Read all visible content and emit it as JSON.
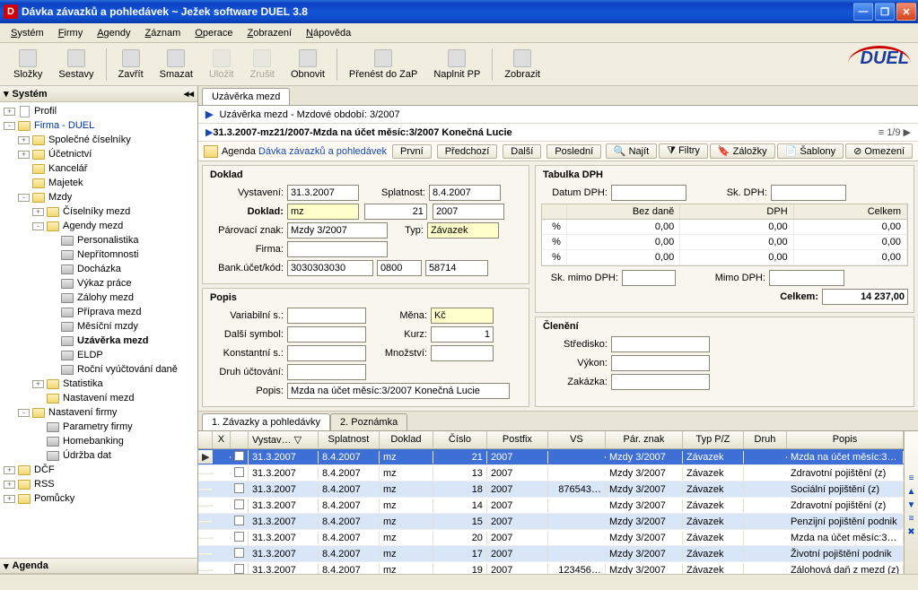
{
  "window": {
    "title": "Dávka závazků a pohledávek ~ Ježek software DUEL 3.8",
    "appIconLetter": "D"
  },
  "menu": [
    "Systém",
    "Firmy",
    "Agendy",
    "Záznam",
    "Operace",
    "Zobrazení",
    "Nápověda"
  ],
  "toolbar": {
    "items": [
      {
        "label": "Složky",
        "disabled": false
      },
      {
        "label": "Sestavy",
        "disabled": false
      },
      {
        "sep": true
      },
      {
        "label": "Zavřít",
        "disabled": false
      },
      {
        "label": "Smazat",
        "disabled": false
      },
      {
        "label": "Uložit",
        "disabled": true
      },
      {
        "label": "Zrušit",
        "disabled": true
      },
      {
        "label": "Obnovit",
        "disabled": false
      },
      {
        "sep": true
      },
      {
        "label": "Přenést do ZaP",
        "disabled": false
      },
      {
        "label": "Naplnit PP",
        "disabled": false
      },
      {
        "sep": true
      },
      {
        "label": "Zobrazit",
        "disabled": false
      }
    ],
    "logo": "DUEL"
  },
  "leftPane": {
    "header": "Systém",
    "footer": "Agenda",
    "tree": [
      {
        "d": 0,
        "tw": "+",
        "ico": "page",
        "label": "Profil"
      },
      {
        "d": 0,
        "tw": "-",
        "ico": "folder",
        "label": "Firma - DUEL",
        "blue": true
      },
      {
        "d": 1,
        "tw": "+",
        "ico": "folder",
        "label": "Společné číselníky"
      },
      {
        "d": 1,
        "tw": "+",
        "ico": "folder",
        "label": "Účetnictví"
      },
      {
        "d": 1,
        "tw": "",
        "ico": "folder",
        "label": "Kancelář"
      },
      {
        "d": 1,
        "tw": "",
        "ico": "folder",
        "label": "Majetek"
      },
      {
        "d": 1,
        "tw": "-",
        "ico": "folder",
        "label": "Mzdy"
      },
      {
        "d": 2,
        "tw": "+",
        "ico": "folder",
        "label": "Číselníky mezd"
      },
      {
        "d": 2,
        "tw": "-",
        "ico": "folder",
        "label": "Agendy mezd"
      },
      {
        "d": 3,
        "tw": "",
        "ico": "folderg",
        "label": "Personalistika"
      },
      {
        "d": 3,
        "tw": "",
        "ico": "folderg",
        "label": "Nepřítomnosti"
      },
      {
        "d": 3,
        "tw": "",
        "ico": "folderg",
        "label": "Docházka"
      },
      {
        "d": 3,
        "tw": "",
        "ico": "folderg",
        "label": "Výkaz práce"
      },
      {
        "d": 3,
        "tw": "",
        "ico": "folderg",
        "label": "Zálohy mezd"
      },
      {
        "d": 3,
        "tw": "",
        "ico": "folderg",
        "label": "Příprava mezd"
      },
      {
        "d": 3,
        "tw": "",
        "ico": "folderg",
        "label": "Měsíční mzdy"
      },
      {
        "d": 3,
        "tw": "",
        "ico": "folderg",
        "label": "Uzávěrka mezd",
        "bold": true
      },
      {
        "d": 3,
        "tw": "",
        "ico": "folderg",
        "label": "ELDP"
      },
      {
        "d": 3,
        "tw": "",
        "ico": "folderg",
        "label": "Roční vyúčtování daně"
      },
      {
        "d": 2,
        "tw": "+",
        "ico": "folder",
        "label": "Statistika"
      },
      {
        "d": 2,
        "tw": "",
        "ico": "folder",
        "label": "Nastavení mezd"
      },
      {
        "d": 1,
        "tw": "-",
        "ico": "folder",
        "label": "Nastavení firmy"
      },
      {
        "d": 2,
        "tw": "",
        "ico": "folderg",
        "label": "Parametry firmy"
      },
      {
        "d": 2,
        "tw": "",
        "ico": "folderg",
        "label": "Homebanking"
      },
      {
        "d": 2,
        "tw": "",
        "ico": "folderg",
        "label": "Údržba dat"
      },
      {
        "d": 0,
        "tw": "+",
        "ico": "folder",
        "label": "DČF"
      },
      {
        "d": 0,
        "tw": "+",
        "ico": "folder",
        "label": "RSS"
      },
      {
        "d": 0,
        "tw": "+",
        "ico": "folder",
        "label": "Pomůcky"
      }
    ]
  },
  "tabs": {
    "main": "Uzávěrka mezd"
  },
  "crumbs": {
    "line1a": "Uzávěrka mezd - Mzdové období: 3/2007",
    "line2": "31.3.2007-mz21/2007-Mzda na účet měsíc:3/2007 Konečná Lucie",
    "pager": "1/9"
  },
  "agendaBar": {
    "prefix": "Agenda",
    "link": "Dávka závazků a pohledávek",
    "nav": [
      "První",
      "Předchozí",
      "Další",
      "Poslední"
    ],
    "right": [
      "Najít",
      "Filtry",
      "Záložky",
      "Šablony",
      "Omezení"
    ]
  },
  "form": {
    "doklad": {
      "title": "Doklad",
      "vystaveniL": "Vystavení:",
      "vystaveni": "31.3.2007",
      "splatnostL": "Splatnost:",
      "splatnost": "8.4.2007",
      "dokladL": "Doklad:",
      "dokladA": "mz",
      "dokladB": "21",
      "dokladC": "2007",
      "parZnakL": "Párovací znak:",
      "parZnak": "Mzdy 3/2007",
      "typL": "Typ:",
      "typ": "Závazek",
      "firmaL": "Firma:",
      "firma": "",
      "bankL": "Bank.účet/kód:",
      "bankA": "3030303030",
      "bankB": "0800",
      "bankC": "58714"
    },
    "popis": {
      "title": "Popis",
      "varSL": "Variabilní s.:",
      "varS": "",
      "dalsiL": "Další symbol:",
      "dalsi": "",
      "konstL": "Konstantní s.:",
      "konst": "",
      "druhL": "Druh účtování:",
      "druh": "",
      "popisL": "Popis:",
      "popis": "Mzda na účet měsíc:3/2007 Konečná Lucie",
      "menaL": "Měna:",
      "mena": "Kč",
      "kurzL": "Kurz:",
      "kurz": "1",
      "mnozL": "Množství:",
      "mnoz": ""
    },
    "dph": {
      "title": "Tabulka DPH",
      "datumL": "Datum DPH:",
      "datum": "",
      "skL": "Sk. DPH:",
      "sk": "",
      "cols": [
        "Bez daně",
        "DPH",
        "Celkem"
      ],
      "rows": [
        [
          "%",
          "0,00",
          "0,00",
          "0,00"
        ],
        [
          "%",
          "0,00",
          "0,00",
          "0,00"
        ],
        [
          "%",
          "0,00",
          "0,00",
          "0,00"
        ]
      ],
      "skMimoL": "Sk. mimo DPH:",
      "skMimo": "",
      "mimoL": "Mimo DPH:",
      "mimo": "",
      "celkemL": "Celkem:",
      "celkem": "14 237,00"
    },
    "cleneni": {
      "title": "Členění",
      "strediskoL": "Středisko:",
      "stredisko": "",
      "vykonL": "Výkon:",
      "vykon": "",
      "zakazkaL": "Zakázka:",
      "zakazka": ""
    }
  },
  "gridTabs": [
    "1. Závazky a pohledávky",
    "2. Poznámka"
  ],
  "grid": {
    "headers": [
      "X",
      "",
      "Vystav…",
      "Splatnost",
      "Doklad",
      "Číslo",
      "Postfix",
      "VS",
      "Pár. znak",
      "Typ P/Z",
      "Druh",
      "Popis"
    ],
    "rows": [
      {
        "sel": true,
        "vyst": "31.3.2007",
        "spl": "8.4.2007",
        "dok": "mz",
        "cis": "21",
        "post": "2007",
        "vs": "",
        "par": "Mzdy 3/2007",
        "typ": "Závazek",
        "druh": "",
        "pop": "Mzda na účet měsíc:3…"
      },
      {
        "vyst": "31.3.2007",
        "spl": "8.4.2007",
        "dok": "mz",
        "cis": "13",
        "post": "2007",
        "vs": "",
        "par": "Mzdy 3/2007",
        "typ": "Závazek",
        "druh": "",
        "pop": "Zdravotní pojištění (z)"
      },
      {
        "alt": true,
        "vyst": "31.3.2007",
        "spl": "8.4.2007",
        "dok": "mz",
        "cis": "18",
        "post": "2007",
        "vs": "876543…",
        "par": "Mzdy 3/2007",
        "typ": "Závazek",
        "druh": "",
        "pop": "Sociální pojištění (z)"
      },
      {
        "vyst": "31.3.2007",
        "spl": "8.4.2007",
        "dok": "mz",
        "cis": "14",
        "post": "2007",
        "vs": "",
        "par": "Mzdy 3/2007",
        "typ": "Závazek",
        "druh": "",
        "pop": "Zdravotní pojištění (z)"
      },
      {
        "alt": true,
        "vyst": "31.3.2007",
        "spl": "8.4.2007",
        "dok": "mz",
        "cis": "15",
        "post": "2007",
        "vs": "",
        "par": "Mzdy 3/2007",
        "typ": "Závazek",
        "druh": "",
        "pop": "Penzijní pojištění podnik"
      },
      {
        "vyst": "31.3.2007",
        "spl": "8.4.2007",
        "dok": "mz",
        "cis": "20",
        "post": "2007",
        "vs": "",
        "par": "Mzdy 3/2007",
        "typ": "Závazek",
        "druh": "",
        "pop": "Mzda na účet měsíc:3…"
      },
      {
        "alt": true,
        "vyst": "31.3.2007",
        "spl": "8.4.2007",
        "dok": "mz",
        "cis": "17",
        "post": "2007",
        "vs": "",
        "par": "Mzdy 3/2007",
        "typ": "Závazek",
        "druh": "",
        "pop": "Životní pojištění podnik"
      },
      {
        "vyst": "31.3.2007",
        "spl": "8.4.2007",
        "dok": "mz",
        "cis": "19",
        "post": "2007",
        "vs": "123456…",
        "par": "Mzdy 3/2007",
        "typ": "Závazek",
        "druh": "",
        "pop": "Zálohová daň z mezd (z)"
      }
    ],
    "sideMarkers": [
      "≡",
      "▲",
      "▼",
      "≡",
      "✖"
    ]
  }
}
